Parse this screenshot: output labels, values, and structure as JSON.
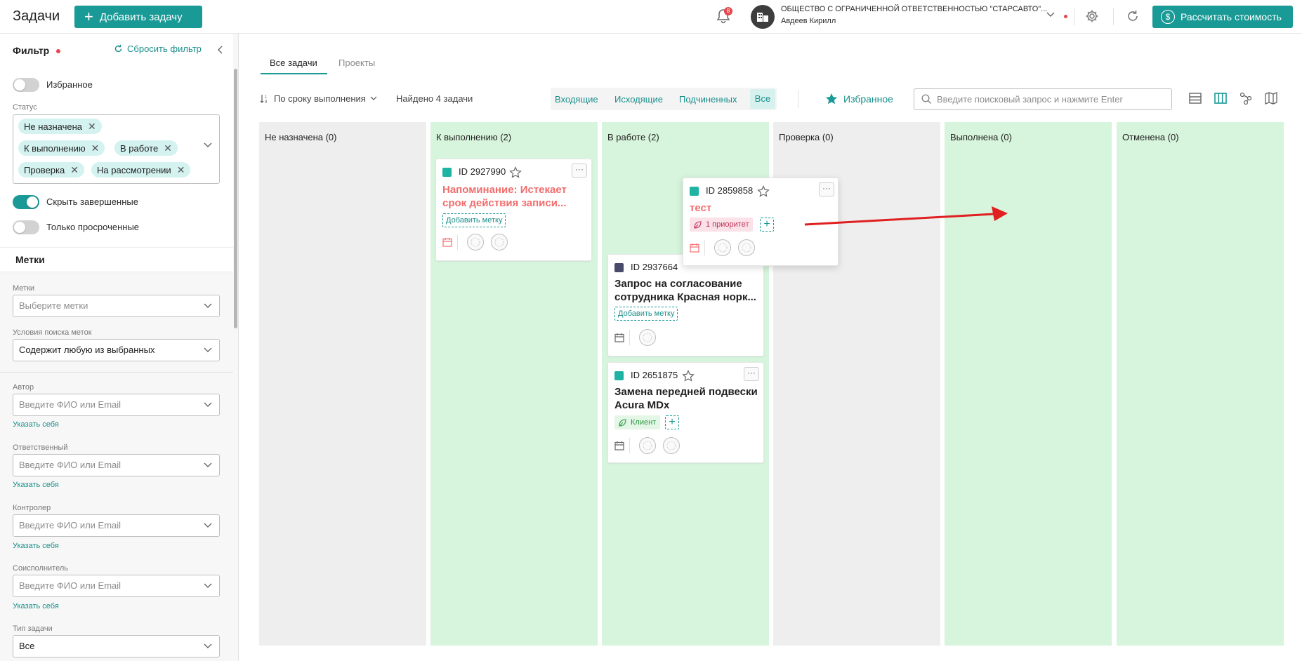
{
  "header": {
    "title": "Задачи",
    "add_task_label": "Добавить задачу",
    "notifications_count": "8",
    "org_name": "ОБЩЕСТВО С ОГРАНИЧЕННОЙ ОТВЕТСТВЕННОСТЬЮ \"СТАРСАВТО\"...",
    "user_name": "Авдеев Кирилл",
    "calc_label": "Рассчитать стоимость",
    "accent_color": "#1a9a96"
  },
  "sidebar": {
    "filter_title": "Фильтр",
    "reset_label": "Сбросить фильтр",
    "favorites_label": "Избранное",
    "favorites_on": false,
    "status_label": "Статус",
    "status_chips": [
      "Не назначена",
      "К выполнению",
      "В работе",
      "Проверка",
      "На рассмотрении"
    ],
    "hide_done_label": "Скрыть завершенные",
    "hide_done_on": true,
    "overdue_label": "Только просроченные",
    "overdue_on": false,
    "tags_section": "Метки",
    "tags_label": "Метки",
    "tags_placeholder": "Выберите метки",
    "tag_cond_label": "Условия поиска меток",
    "tag_cond_value": "Содержит любую из выбранных",
    "author_label": "Автор",
    "responsible_label": "Ответственный",
    "controller_label": "Контролер",
    "coexecutor_label": "Соисполнитель",
    "person_placeholder": "Введите ФИО или Email",
    "self_link": "Указать себя",
    "task_type_label": "Тип задачи",
    "task_type_value": "Все"
  },
  "main": {
    "tabs": [
      "Все задачи",
      "Проекты"
    ],
    "sort_label": "По сроку выполнения",
    "found_label": "Найдено 4 задачи",
    "segments": [
      "Входящие",
      "Исходящие",
      "Подчиненных",
      "Все"
    ],
    "favorites_button": "Избранное",
    "search_placeholder": "Введите поисковый запрос и нажмите Enter"
  },
  "board": {
    "columns": [
      {
        "title": "Не назначена (0)"
      },
      {
        "title": "К выполнению (2)"
      },
      {
        "title": "В работе (2)"
      },
      {
        "title": "Проверка (0)"
      },
      {
        "title": "Выполнена (0)"
      },
      {
        "title": "Отменена (0)"
      }
    ],
    "cards": [
      {
        "id": "ID 2927990",
        "title_1": "Напоминание: Истекает",
        "title_2": "срок действия записи...",
        "add_tag": "Добавить метку"
      },
      {
        "id": "ID 2859858",
        "title_1": "тест",
        "tag": "1 приоритет"
      },
      {
        "id": "ID 2937664",
        "title_1": "Запрос на согласование",
        "title_2": "сотрудника Красная норк...",
        "add_tag": "Добавить метку"
      },
      {
        "id": "ID 2651875",
        "title_1": "Замена передней подвески",
        "title_2": "Acura MDx",
        "tag": "Клиент"
      }
    ],
    "menu_glyph": "···",
    "plus_glyph": "+"
  }
}
